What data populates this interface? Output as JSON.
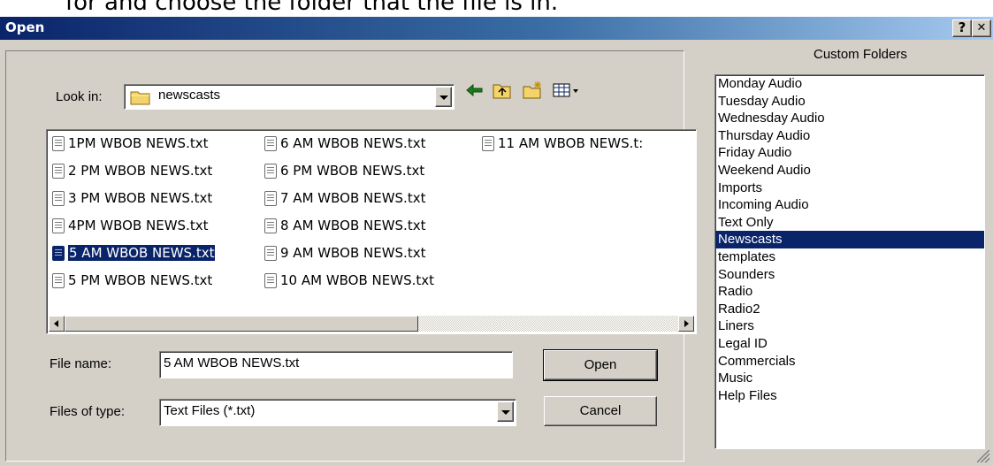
{
  "background_text": "for and choose the folder that the file is in.",
  "window": {
    "title": "Open",
    "help_label": "?",
    "close_label": "✕"
  },
  "look_in": {
    "label": "Look in:",
    "value": "newscasts"
  },
  "toolbar_icons": [
    "back-arrow-icon",
    "up-folder-icon",
    "new-folder-icon",
    "view-menu-icon"
  ],
  "files": [
    {
      "name": "1PM WBOB NEWS.txt",
      "selected": false
    },
    {
      "name": "2 PM WBOB NEWS.txt",
      "selected": false
    },
    {
      "name": "3 PM WBOB NEWS.txt",
      "selected": false
    },
    {
      "name": "4PM WBOB NEWS.txt",
      "selected": false
    },
    {
      "name": "5 AM WBOB NEWS.txt",
      "selected": true
    },
    {
      "name": "5 PM WBOB NEWS.txt",
      "selected": false
    },
    {
      "name": "6 AM WBOB NEWS.txt",
      "selected": false
    },
    {
      "name": "6 PM WBOB NEWS.txt",
      "selected": false
    },
    {
      "name": "7 AM WBOB NEWS.txt",
      "selected": false
    },
    {
      "name": "8 AM WBOB NEWS.txt",
      "selected": false
    },
    {
      "name": "9 AM WBOB NEWS.txt",
      "selected": false
    },
    {
      "name": "10 AM WBOB NEWS.txt",
      "selected": false
    },
    {
      "name": "11 AM WBOB NEWS.t:",
      "selected": false
    }
  ],
  "file_name": {
    "label": "File name:",
    "value": "5 AM WBOB NEWS.txt"
  },
  "files_of_type": {
    "label": "Files of type:",
    "value": "Text Files (*.txt)"
  },
  "buttons": {
    "open": "Open",
    "cancel": "Cancel"
  },
  "custom_folders": {
    "title": "Custom Folders",
    "items": [
      {
        "label": "Monday Audio",
        "selected": false
      },
      {
        "label": "Tuesday Audio",
        "selected": false
      },
      {
        "label": "Wednesday Audio",
        "selected": false
      },
      {
        "label": "Thursday Audio",
        "selected": false
      },
      {
        "label": "Friday Audio",
        "selected": false
      },
      {
        "label": "Weekend Audio",
        "selected": false
      },
      {
        "label": "Imports",
        "selected": false
      },
      {
        "label": "Incoming Audio",
        "selected": false
      },
      {
        "label": "Text Only",
        "selected": false
      },
      {
        "label": "Newscasts",
        "selected": true
      },
      {
        "label": "templates",
        "selected": false
      },
      {
        "label": "Sounders",
        "selected": false
      },
      {
        "label": "Radio",
        "selected": false
      },
      {
        "label": "Radio2",
        "selected": false
      },
      {
        "label": "Liners",
        "selected": false
      },
      {
        "label": "Legal ID",
        "selected": false
      },
      {
        "label": "Commercials",
        "selected": false
      },
      {
        "label": "Music",
        "selected": false
      },
      {
        "label": "Help Files",
        "selected": false
      }
    ]
  },
  "colors": {
    "selection": "#0a246a",
    "face": "#d4d0c8",
    "title_start": "#0a246a",
    "title_end": "#a6caf0"
  }
}
